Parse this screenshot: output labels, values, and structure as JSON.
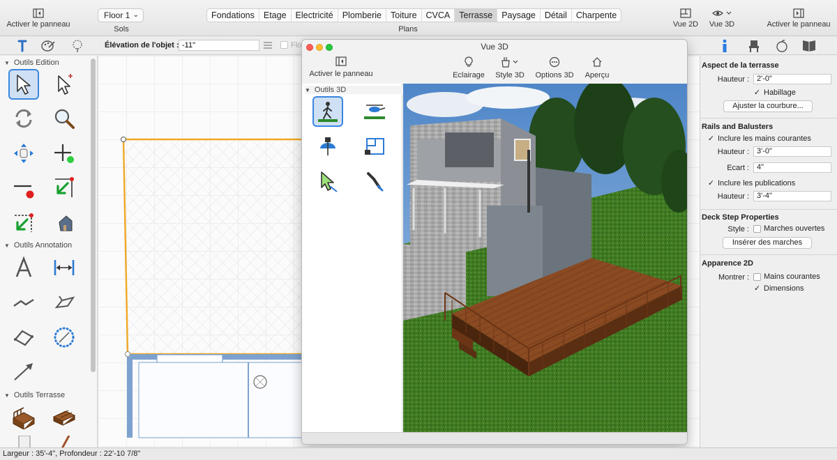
{
  "topbar": {
    "left_panel_label": "Activer le panneau",
    "floor_value": "Floor 1",
    "floor_caption": "Sols",
    "plans_tabs": [
      "Fondations",
      "Etage",
      "Electricité",
      "Plomberie",
      "Toiture",
      "CVCA",
      "Terrasse",
      "Paysage",
      "Détail",
      "Charpente"
    ],
    "plans_active": "Terrasse",
    "plans_caption": "Plans",
    "view2d_label": "Vue 2D",
    "view3d_label": "Vue 3D",
    "right_panel_label": "Activer le panneau"
  },
  "subbar": {
    "elevation_label": "Élévation de l'objet :",
    "elevation_value": "-11\"",
    "flo_label": "Flo"
  },
  "palette": {
    "edition_title": "Outils Edition",
    "annotation_title": "Outils Annotation",
    "terrasse_title": "Outils Terrasse"
  },
  "view3d": {
    "title": "Vue 3D",
    "panel_label": "Activer le panneau",
    "eclairage_label": "Eclairage",
    "style_label": "Style 3D",
    "options_label": "Options 3D",
    "apercu_label": "Aperçu",
    "tools_title": "Outils 3D"
  },
  "right": {
    "aspect_title": "Aspect de la terrasse",
    "hauteur_label": "Hauteur :",
    "hauteur_value": "2'-0\"",
    "habillage_label": "Habillage",
    "ajuster_label": "Ajuster la courbure...",
    "rails_title": "Rails and Balusters",
    "mains_label": "Inclure les mains courantes",
    "rails_hauteur_label": "Hauteur :",
    "rails_hauteur_value": "3'-0\"",
    "ecart_label": "Ecart :",
    "ecart_value": "4\"",
    "publications_label": "Inclure les publications",
    "pub_hauteur_label": "Hauteur :",
    "pub_hauteur_value": "3'-4\"",
    "deck_title": "Deck Step Properties",
    "style_label": "Style :",
    "marches_ouvertes_label": "Marches ouvertes",
    "inserer_label": "Insérer des marches",
    "apparence_title": "Apparence 2D",
    "montrer_label": "Montrer :",
    "mains_courantes_label": "Mains courantes",
    "dimensions_label": "Dimensions"
  },
  "status": {
    "text": "Largeur : 35'-4\", Profondeur : 22'-10 7/8\""
  },
  "colors": {
    "accent": "#3a86e0",
    "deck_outline": "#f0a825",
    "wall_blue": "#7da2cf",
    "deck_wood": "#8a4a22",
    "grass": "#3f7a23"
  }
}
